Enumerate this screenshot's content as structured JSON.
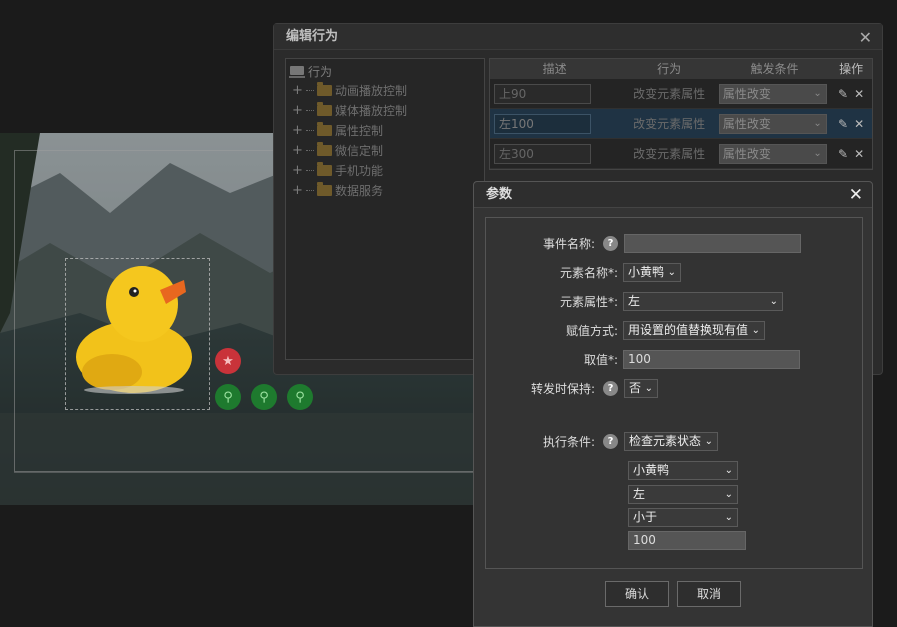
{
  "behavior_dialog": {
    "title": "编辑行为",
    "close": "✕",
    "tree": {
      "root": "行为",
      "items": [
        "动画播放控制",
        "媒体播放控制",
        "属性控制",
        "微信定制",
        "手机功能",
        "数据服务"
      ]
    },
    "table": {
      "headers": [
        "描述",
        "行为",
        "触发条件",
        "操作"
      ],
      "rows": [
        {
          "desc": "上90",
          "action": "改变元素属性",
          "trigger": "属性改变",
          "selected": false
        },
        {
          "desc": "左100",
          "action": "改变元素属性",
          "trigger": "属性改变",
          "selected": true
        },
        {
          "desc": "左300",
          "action": "改变元素属性",
          "trigger": "属性改变",
          "selected": false
        }
      ]
    }
  },
  "params_dialog": {
    "title": "参数",
    "close": "✕",
    "fields": {
      "event_name_label": "事件名称:",
      "event_name_value": "",
      "element_name_label": "元素名称*:",
      "element_name_value": "小黄鸭",
      "element_attr_label": "元素属性*:",
      "element_attr_value": "左",
      "assign_mode_label": "赋值方式:",
      "assign_mode_value": "用设置的值替换现有值",
      "value_label": "取值*:",
      "value_value": "100",
      "keep_on_forward_label": "转发时保持:",
      "keep_on_forward_value": "否",
      "exec_condition_label": "执行条件:",
      "exec_condition_value": "检查元素状态",
      "cond_element": "小黄鸭",
      "cond_attr": "左",
      "cond_op": "小于",
      "cond_value": "100"
    },
    "confirm": "确认",
    "cancel": "取消",
    "help_glyph": "?"
  },
  "colors": {
    "arrow": "#e03a3a",
    "duck": "#f2c21a",
    "beak": "#e8671f"
  }
}
